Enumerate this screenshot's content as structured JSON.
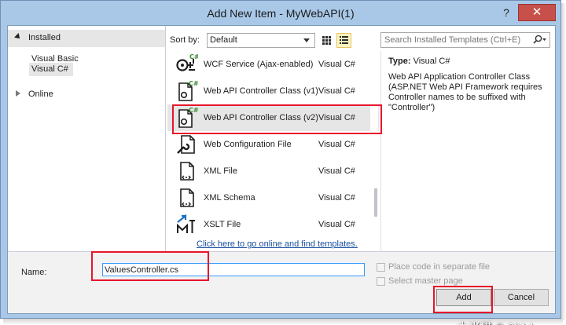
{
  "window": {
    "title": "Add New Item - MyWebAPI(1)",
    "help_glyph": "?",
    "close_glyph": "✕"
  },
  "sidebar": {
    "installed_label": "Installed",
    "items": [
      {
        "label": "Visual Basic"
      },
      {
        "label": "Visual C#",
        "selected": true
      }
    ],
    "online_label": "Online"
  },
  "toolbar": {
    "sort_label": "Sort by:",
    "sort_value": "Default",
    "search_placeholder": "Search Installed Templates (Ctrl+E)"
  },
  "templates": [
    {
      "name": "WCF Service (Ajax-enabled)",
      "language": "Visual C#",
      "icon": "wcf-service-icon"
    },
    {
      "name": "Web API Controller Class (v1)",
      "language": "Visual C#",
      "icon": "controller-class-icon"
    },
    {
      "name": "Web API Controller Class (v2)",
      "language": "Visual C#",
      "icon": "controller-class-icon",
      "selected": true
    },
    {
      "name": "Web Configuration File",
      "language": "Visual C#",
      "icon": "web-config-icon"
    },
    {
      "name": "XML File",
      "language": "Visual C#",
      "icon": "xml-file-icon"
    },
    {
      "name": "XML Schema",
      "language": "Visual C#",
      "icon": "xml-schema-icon"
    },
    {
      "name": "XSLT File",
      "language": "Visual C#",
      "icon": "xslt-file-icon"
    }
  ],
  "online_link": "Click here to go online and find templates.",
  "details": {
    "type_label": "Type:",
    "type_value": "Visual C#",
    "description": "Web API Application Controller Class (ASP.NET Web API Framework requires Controller names to be suffixed with \"Controller\")"
  },
  "form": {
    "name_label": "Name:",
    "name_value": "ValuesController.cs",
    "place_code_label": "Place code in separate file",
    "select_master_label": "Select master page"
  },
  "buttons": {
    "add": "Add",
    "cancel": "Cancel"
  },
  "watermark": "木米猫 © 2014",
  "colors": {
    "window_frame": "#a9c8e8",
    "highlight_red": "#e8152b",
    "selection": "#e6e6e6",
    "close_button": "#c7504a",
    "link": "#1a4fa0"
  }
}
